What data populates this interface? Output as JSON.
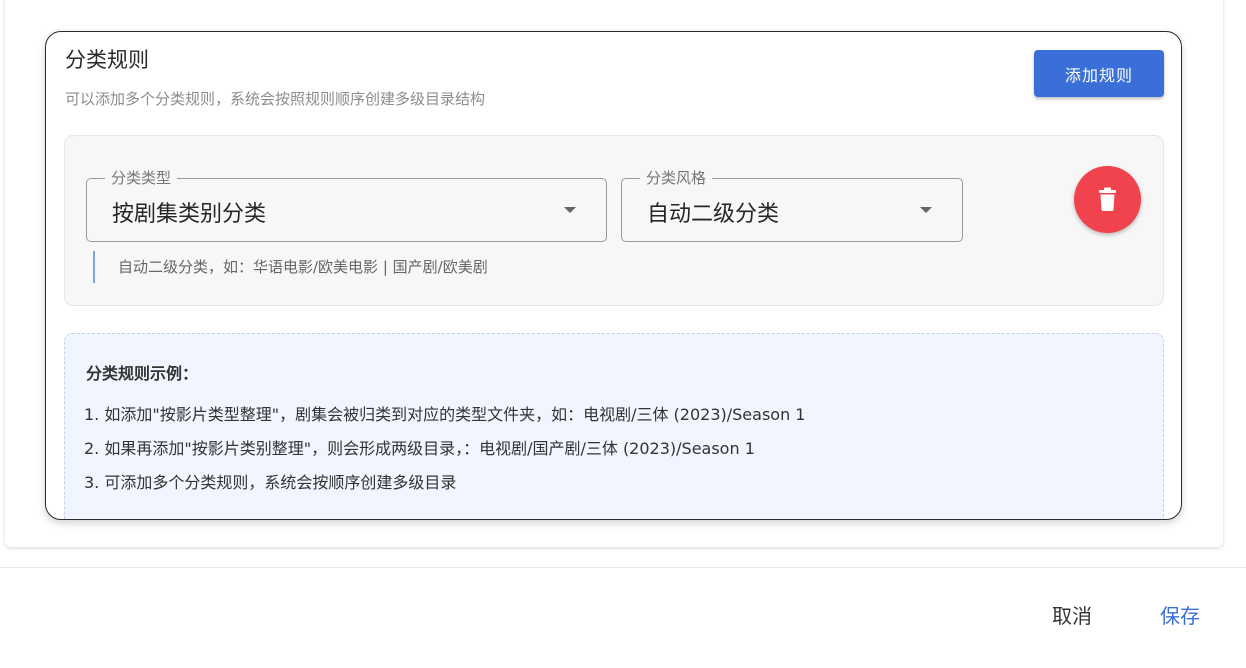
{
  "rules_card": {
    "title": "分类规则",
    "subtitle": "可以添加多个分类规则，系统会按照规则顺序创建多级目录结构",
    "add_rule_label": "添加规则"
  },
  "rule": {
    "category_type": {
      "label": "分类类型",
      "value": "按剧集类别分类"
    },
    "category_style": {
      "label": "分类风格",
      "value": "自动二级分类"
    },
    "hint": "自动二级分类，如：华语电影/欧美电影 | 国产剧/欧美剧",
    "delete_icon": "trash-icon"
  },
  "examples": {
    "title": "分类规则示例：",
    "lines": [
      "1. 如添加\"按影片类型整理\"，剧集会被归类到对应的类型文件夹，如：电视剧/三体 (2023)/Season 1",
      "2. 如果再添加\"按影片类别整理\"，则会形成两级目录，：电视剧/国产剧/三体 (2023)/Season 1",
      "3. 可添加多个分类规则，系统会按顺序创建多级目录"
    ]
  },
  "footer": {
    "cancel_label": "取消",
    "save_label": "保存"
  },
  "colors": {
    "primary": "#3b6fd8",
    "danger": "#f0434d",
    "example_bg": "#f0f5ff",
    "rule_bg": "#f7f7f7"
  }
}
